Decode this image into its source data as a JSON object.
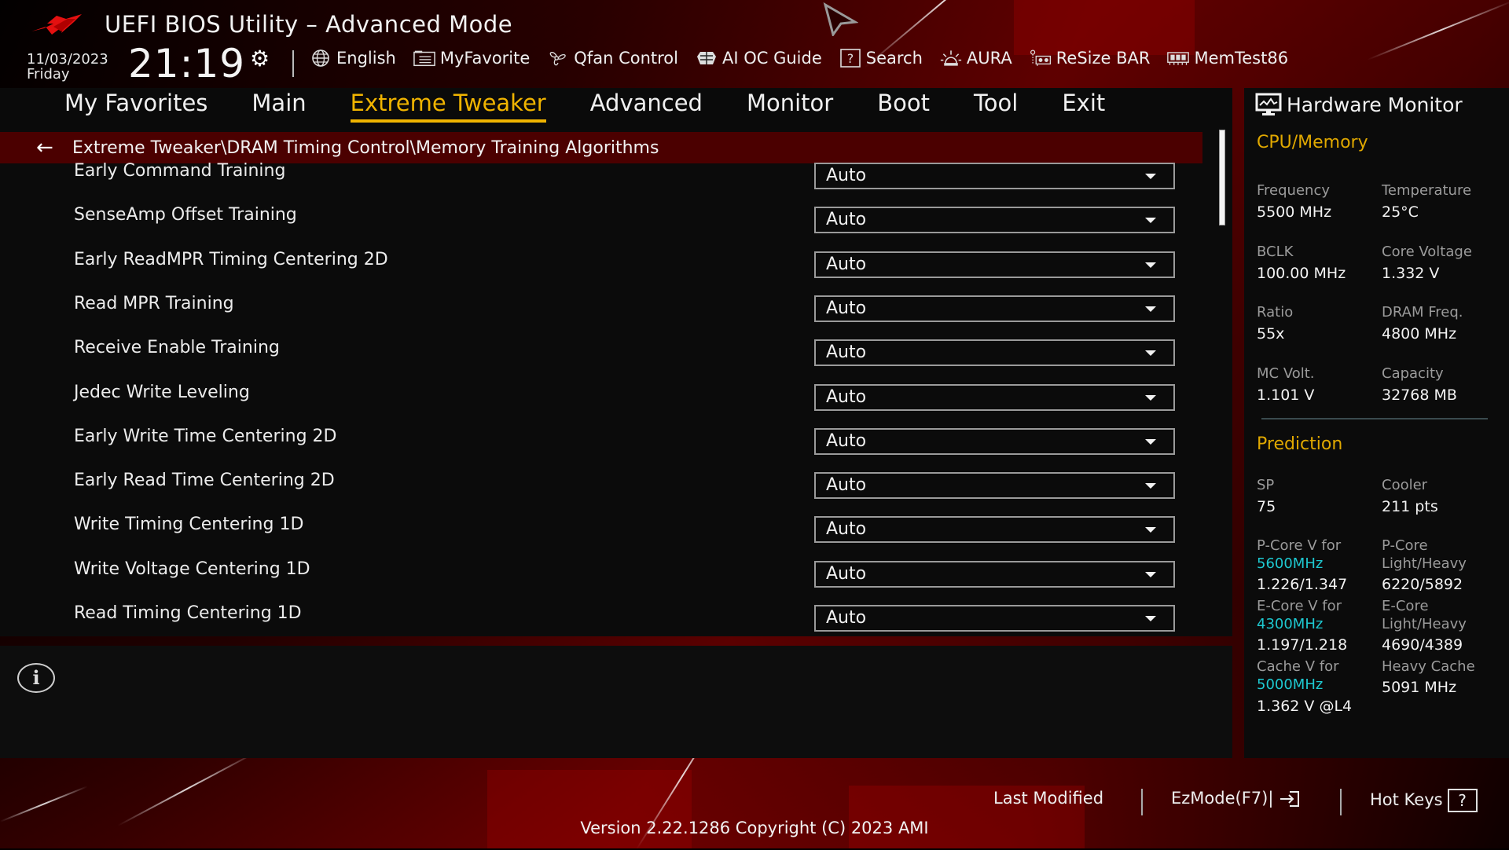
{
  "header": {
    "title": "UEFI BIOS Utility – Advanced Mode",
    "date": "11/03/2023",
    "day": "Friday",
    "time": "21:19",
    "toolbar": [
      {
        "label": "English",
        "icon": "globe-icon"
      },
      {
        "label": "MyFavorite",
        "icon": "favorite-list-icon"
      },
      {
        "label": "Qfan Control",
        "icon": "fan-icon"
      },
      {
        "label": "AI OC Guide",
        "icon": "ai-chip-icon"
      },
      {
        "label": "Search",
        "icon": "search-help-icon"
      },
      {
        "label": "AURA",
        "icon": "aura-light-icon"
      },
      {
        "label": "ReSize BAR",
        "icon": "resize-bar-icon"
      },
      {
        "label": "MemTest86",
        "icon": "memory-icon"
      }
    ]
  },
  "nav": {
    "tabs": [
      {
        "label": "My Favorites",
        "active": false
      },
      {
        "label": "Main",
        "active": false
      },
      {
        "label": "Extreme Tweaker",
        "active": true
      },
      {
        "label": "Advanced",
        "active": false
      },
      {
        "label": "Monitor",
        "active": false
      },
      {
        "label": "Boot",
        "active": false
      },
      {
        "label": "Tool",
        "active": false
      },
      {
        "label": "Exit",
        "active": false
      }
    ]
  },
  "breadcrumb": "Extreme Tweaker\\DRAM Timing Control\\Memory Training Algorithms",
  "settings": [
    {
      "label": "Early Command Training",
      "value": "Auto"
    },
    {
      "label": "SenseAmp Offset Training",
      "value": "Auto"
    },
    {
      "label": "Early ReadMPR Timing Centering 2D",
      "value": "Auto"
    },
    {
      "label": "Read MPR Training",
      "value": "Auto"
    },
    {
      "label": "Receive Enable Training",
      "value": "Auto"
    },
    {
      "label": "Jedec Write Leveling",
      "value": "Auto"
    },
    {
      "label": "Early Write Time Centering 2D",
      "value": "Auto"
    },
    {
      "label": "Early Read Time Centering 2D",
      "value": "Auto"
    },
    {
      "label": "Write Timing Centering 1D",
      "value": "Auto"
    },
    {
      "label": "Write Voltage Centering 1D",
      "value": "Auto"
    },
    {
      "label": "Read Timing Centering 1D",
      "value": "Auto"
    }
  ],
  "hardware_monitor": {
    "title": "Hardware Monitor",
    "cpu_memory": {
      "heading": "CPU/Memory",
      "items": [
        {
          "label": "Frequency",
          "value": "5500 MHz"
        },
        {
          "label": "Temperature",
          "value": "25°C"
        },
        {
          "label": "BCLK",
          "value": "100.00 MHz"
        },
        {
          "label": "Core Voltage",
          "value": "1.332 V"
        },
        {
          "label": "Ratio",
          "value": "55x"
        },
        {
          "label": "DRAM Freq.",
          "value": "4800 MHz"
        },
        {
          "label": "MC Volt.",
          "value": "1.101 V"
        },
        {
          "label": "Capacity",
          "value": "32768 MB"
        }
      ]
    },
    "prediction": {
      "heading": "Prediction",
      "sp_label": "SP",
      "sp_value": "75",
      "cooler_label": "Cooler",
      "cooler_value": "211 pts",
      "pcore_v_label": "P-Core V for",
      "pcore_v_freq": "5600MHz",
      "pcore_v_value": "1.226/1.347",
      "pcore_lh_label1": "P-Core",
      "pcore_lh_label2": "Light/Heavy",
      "pcore_lh_value": "6220/5892",
      "ecore_v_label": "E-Core V for",
      "ecore_v_freq": "4300MHz",
      "ecore_v_value": "1.197/1.218",
      "ecore_lh_label1": "E-Core",
      "ecore_lh_label2": "Light/Heavy",
      "ecore_lh_value": "4690/4389",
      "cache_v_label": "Cache V for",
      "cache_v_freq": "5000MHz",
      "cache_v_value": "1.362 V @L4",
      "heavy_cache_label": "Heavy Cache",
      "heavy_cache_value": "5091 MHz"
    }
  },
  "footer": {
    "last_modified": "Last Modified",
    "ezmode": "EzMode(F7)|",
    "hotkeys": "Hot Keys",
    "hotkeys_key": "?",
    "version": "Version 2.22.1286 Copyright (C) 2023 AMI"
  },
  "colors": {
    "accent": "#f0b400",
    "breadcrumb_bg": "#4b0000",
    "highlight_cyan": "#1ec8d0"
  }
}
